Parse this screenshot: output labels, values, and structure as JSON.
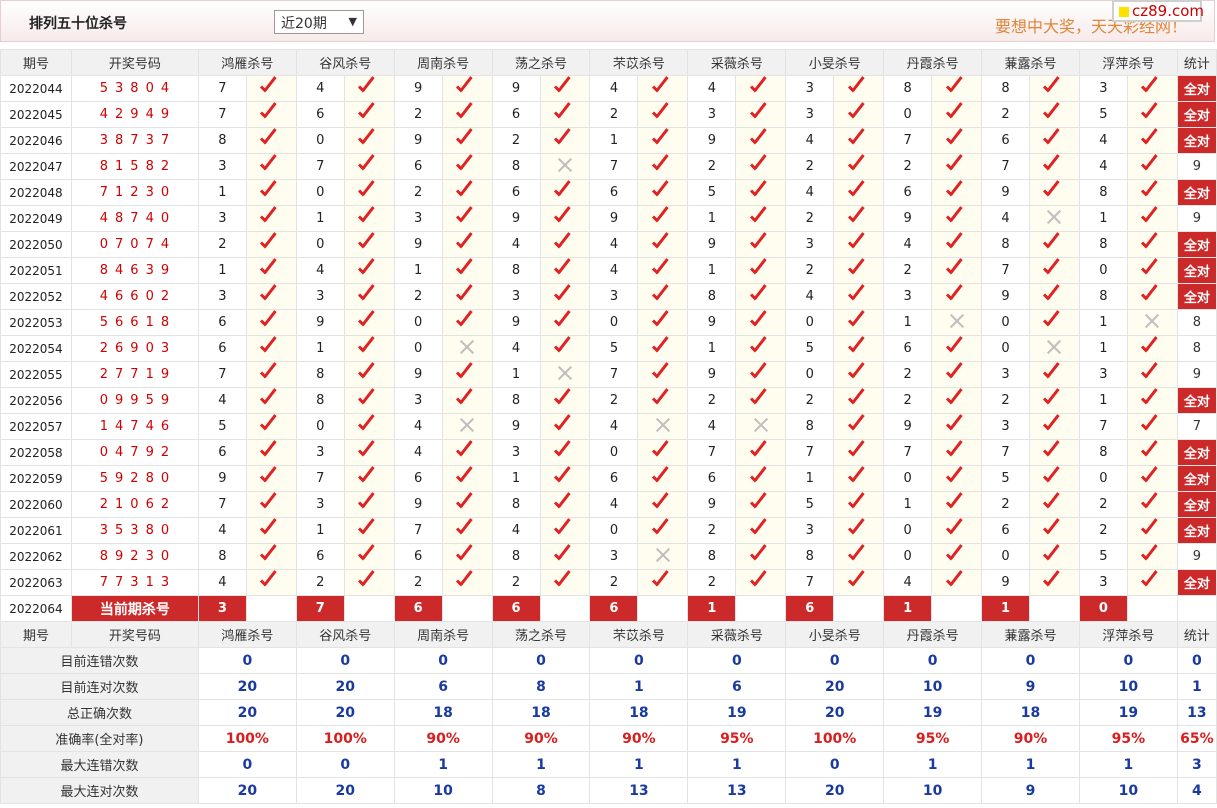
{
  "header": {
    "title": "排列五十位杀号",
    "period": "近20期",
    "slogan": "要想中大奖，天天彩经网！",
    "badge": "cz89.com"
  },
  "columns": {
    "issue": "期号",
    "win": "开奖号码",
    "experts": [
      "鸿雁杀号",
      "谷风杀号",
      "周南杀号",
      "荡之杀号",
      "芣苡杀号",
      "采薇杀号",
      "小旻杀号",
      "丹霞杀号",
      "蒹露杀号",
      "浮萍杀号"
    ],
    "stat": "统计"
  },
  "rows": [
    {
      "issue": "2022044",
      "win": "53804",
      "kills": [
        "7",
        "4",
        "9",
        "9",
        "4",
        "4",
        "3",
        "8",
        "8",
        "3"
      ],
      "ok": [
        1,
        1,
        1,
        1,
        1,
        1,
        1,
        1,
        1,
        1
      ],
      "stat": "全对"
    },
    {
      "issue": "2022045",
      "win": "42949",
      "kills": [
        "7",
        "6",
        "2",
        "6",
        "2",
        "3",
        "3",
        "0",
        "2",
        "5"
      ],
      "ok": [
        1,
        1,
        1,
        1,
        1,
        1,
        1,
        1,
        1,
        1
      ],
      "stat": "全对"
    },
    {
      "issue": "2022046",
      "win": "38737",
      "kills": [
        "8",
        "0",
        "9",
        "2",
        "1",
        "9",
        "4",
        "7",
        "6",
        "4"
      ],
      "ok": [
        1,
        1,
        1,
        1,
        1,
        1,
        1,
        1,
        1,
        1
      ],
      "stat": "全对"
    },
    {
      "issue": "2022047",
      "win": "81582",
      "kills": [
        "3",
        "7",
        "6",
        "8",
        "7",
        "2",
        "2",
        "2",
        "7",
        "4"
      ],
      "ok": [
        1,
        1,
        1,
        0,
        1,
        1,
        1,
        1,
        1,
        1
      ],
      "stat": "9"
    },
    {
      "issue": "2022048",
      "win": "71230",
      "kills": [
        "1",
        "0",
        "2",
        "6",
        "6",
        "5",
        "4",
        "6",
        "9",
        "8"
      ],
      "ok": [
        1,
        1,
        1,
        1,
        1,
        1,
        1,
        1,
        1,
        1
      ],
      "stat": "全对"
    },
    {
      "issue": "2022049",
      "win": "48740",
      "kills": [
        "3",
        "1",
        "3",
        "9",
        "9",
        "1",
        "2",
        "9",
        "4",
        "1"
      ],
      "ok": [
        1,
        1,
        1,
        1,
        1,
        1,
        1,
        1,
        0,
        1
      ],
      "stat": "9"
    },
    {
      "issue": "2022050",
      "win": "07074",
      "kills": [
        "2",
        "0",
        "9",
        "4",
        "4",
        "9",
        "3",
        "4",
        "8",
        "8"
      ],
      "ok": [
        1,
        1,
        1,
        1,
        1,
        1,
        1,
        1,
        1,
        1
      ],
      "stat": "全对"
    },
    {
      "issue": "2022051",
      "win": "84639",
      "kills": [
        "1",
        "4",
        "1",
        "8",
        "4",
        "1",
        "2",
        "2",
        "7",
        "0"
      ],
      "ok": [
        1,
        1,
        1,
        1,
        1,
        1,
        1,
        1,
        1,
        1
      ],
      "stat": "全对"
    },
    {
      "issue": "2022052",
      "win": "46602",
      "kills": [
        "3",
        "3",
        "2",
        "3",
        "3",
        "8",
        "4",
        "3",
        "9",
        "8"
      ],
      "ok": [
        1,
        1,
        1,
        1,
        1,
        1,
        1,
        1,
        1,
        1
      ],
      "stat": "全对"
    },
    {
      "issue": "2022053",
      "win": "56618",
      "kills": [
        "6",
        "9",
        "0",
        "9",
        "0",
        "9",
        "0",
        "1",
        "0",
        "1"
      ],
      "ok": [
        1,
        1,
        1,
        1,
        1,
        1,
        1,
        0,
        1,
        0
      ],
      "stat": "8"
    },
    {
      "issue": "2022054",
      "win": "26903",
      "kills": [
        "6",
        "1",
        "0",
        "4",
        "5",
        "1",
        "5",
        "6",
        "0",
        "1"
      ],
      "ok": [
        1,
        1,
        0,
        1,
        1,
        1,
        1,
        1,
        0,
        1
      ],
      "stat": "8"
    },
    {
      "issue": "2022055",
      "win": "27719",
      "kills": [
        "7",
        "8",
        "9",
        "1",
        "7",
        "9",
        "0",
        "2",
        "3",
        "3"
      ],
      "ok": [
        1,
        1,
        1,
        0,
        1,
        1,
        1,
        1,
        1,
        1
      ],
      "stat": "9"
    },
    {
      "issue": "2022056",
      "win": "09959",
      "kills": [
        "4",
        "8",
        "3",
        "8",
        "2",
        "2",
        "2",
        "2",
        "2",
        "1"
      ],
      "ok": [
        1,
        1,
        1,
        1,
        1,
        1,
        1,
        1,
        1,
        1
      ],
      "stat": "全对"
    },
    {
      "issue": "2022057",
      "win": "14746",
      "kills": [
        "5",
        "0",
        "4",
        "9",
        "4",
        "4",
        "8",
        "9",
        "3",
        "7"
      ],
      "ok": [
        1,
        1,
        0,
        1,
        0,
        0,
        1,
        1,
        1,
        1
      ],
      "stat": "7"
    },
    {
      "issue": "2022058",
      "win": "04792",
      "kills": [
        "6",
        "3",
        "4",
        "3",
        "0",
        "7",
        "7",
        "7",
        "7",
        "8"
      ],
      "ok": [
        1,
        1,
        1,
        1,
        1,
        1,
        1,
        1,
        1,
        1
      ],
      "stat": "全对"
    },
    {
      "issue": "2022059",
      "win": "59280",
      "kills": [
        "9",
        "7",
        "6",
        "1",
        "6",
        "6",
        "1",
        "0",
        "5",
        "0"
      ],
      "ok": [
        1,
        1,
        1,
        1,
        1,
        1,
        1,
        1,
        1,
        1
      ],
      "stat": "全对"
    },
    {
      "issue": "2022060",
      "win": "21062",
      "kills": [
        "7",
        "3",
        "9",
        "8",
        "4",
        "9",
        "5",
        "1",
        "2",
        "2"
      ],
      "ok": [
        1,
        1,
        1,
        1,
        1,
        1,
        1,
        1,
        1,
        1
      ],
      "stat": "全对"
    },
    {
      "issue": "2022061",
      "win": "35380",
      "kills": [
        "4",
        "1",
        "7",
        "4",
        "0",
        "2",
        "3",
        "0",
        "6",
        "2"
      ],
      "ok": [
        1,
        1,
        1,
        1,
        1,
        1,
        1,
        1,
        1,
        1
      ],
      "stat": "全对"
    },
    {
      "issue": "2022062",
      "win": "89230",
      "kills": [
        "8",
        "6",
        "6",
        "8",
        "3",
        "8",
        "8",
        "0",
        "0",
        "5"
      ],
      "ok": [
        1,
        1,
        1,
        1,
        0,
        1,
        1,
        1,
        1,
        1
      ],
      "stat": "9"
    },
    {
      "issue": "2022063",
      "win": "77313",
      "kills": [
        "4",
        "2",
        "2",
        "2",
        "2",
        "2",
        "7",
        "4",
        "9",
        "3"
      ],
      "ok": [
        1,
        1,
        1,
        1,
        1,
        1,
        1,
        1,
        1,
        1
      ],
      "stat": "全对"
    }
  ],
  "current": {
    "issue": "2022064",
    "label": "当前期杀号",
    "kills": [
      "3",
      "7",
      "6",
      "6",
      "6",
      "1",
      "6",
      "1",
      "1",
      "0"
    ]
  },
  "stats": [
    {
      "label": "目前连错次数",
      "values": [
        "0",
        "0",
        "0",
        "0",
        "0",
        "0",
        "0",
        "0",
        "0",
        "0"
      ],
      "stat": "0",
      "rate": false
    },
    {
      "label": "目前连对次数",
      "values": [
        "20",
        "20",
        "6",
        "8",
        "1",
        "6",
        "20",
        "10",
        "9",
        "10"
      ],
      "stat": "1",
      "rate": false
    },
    {
      "label": "总正确次数",
      "values": [
        "20",
        "20",
        "18",
        "18",
        "18",
        "19",
        "20",
        "19",
        "18",
        "19"
      ],
      "stat": "13",
      "rate": false
    },
    {
      "label": "准确率(全对率)",
      "values": [
        "100%",
        "100%",
        "90%",
        "90%",
        "90%",
        "95%",
        "100%",
        "95%",
        "90%",
        "95%"
      ],
      "stat": "65%",
      "rate": true
    },
    {
      "label": "最大连错次数",
      "values": [
        "0",
        "0",
        "1",
        "1",
        "1",
        "1",
        "0",
        "1",
        "1",
        "1"
      ],
      "stat": "3",
      "rate": false
    },
    {
      "label": "最大连对次数",
      "values": [
        "20",
        "20",
        "10",
        "8",
        "13",
        "13",
        "20",
        "10",
        "9",
        "10"
      ],
      "stat": "4",
      "rate": false
    }
  ]
}
